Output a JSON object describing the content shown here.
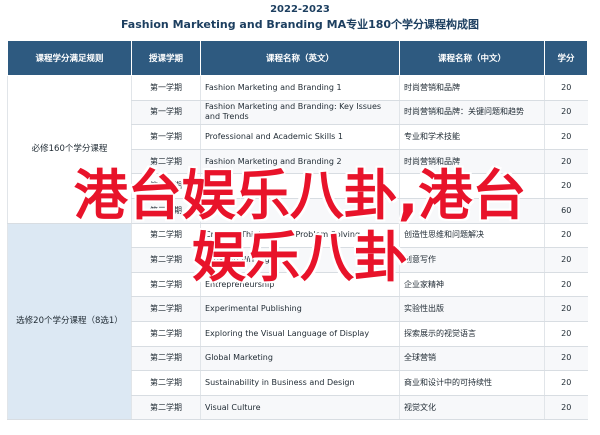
{
  "header": {
    "year": "2022-2023",
    "subtitle": "Fashion Marketing and Branding MA专业180个学分课程构成图"
  },
  "table": {
    "columns": [
      "课程学分满足规则",
      "授课学期",
      "课程名称（英文）",
      "课程名称（中文）",
      "学分"
    ],
    "groups": {
      "required": "必修160个学分课程",
      "elective": "选修20个学分课程（8选1）"
    },
    "rows": [
      {
        "term": "第一学期",
        "en": "Fashion Marketing and Branding 1",
        "zh": "时尚营销和品牌",
        "credits": "20"
      },
      {
        "term": "第一学期",
        "en": "Fashion Marketing and Branding: Key Issues and Trends",
        "zh": "时尚营销和品牌：关键问题和趋势",
        "credits": "20"
      },
      {
        "term": "第一学期",
        "en": "Professional and Academic Skills 1",
        "zh": "专业和学术技能",
        "credits": "20"
      },
      {
        "term": "第二学期",
        "en": "Fashion Marketing and Branding 2",
        "zh": "时尚营销和品牌",
        "credits": "20"
      },
      {
        "term": "第二学期",
        "en": "",
        "zh": "",
        "credits": "20"
      },
      {
        "term": "第三学期",
        "en": "",
        "zh": "",
        "credits": "60"
      },
      {
        "term": "第二学期",
        "en": "Creative Thinking and Problem Solving",
        "zh": "创造性思维和问题解决",
        "credits": "20"
      },
      {
        "term": "第二学期",
        "en": "Creative Writing",
        "zh": "创意写作",
        "credits": "20"
      },
      {
        "term": "第二学期",
        "en": "Entrepreneurship",
        "zh": "企业家精神",
        "credits": "20"
      },
      {
        "term": "第二学期",
        "en": "Experimental Publishing",
        "zh": "实验性出版",
        "credits": "20"
      },
      {
        "term": "第二学期",
        "en": "Exploring the Visual Language of Display",
        "zh": "探索展示的视觉语言",
        "credits": "20"
      },
      {
        "term": "第二学期",
        "en": "Global Marketing",
        "zh": "全球营销",
        "credits": "20"
      },
      {
        "term": "第二学期",
        "en": "Sustainability in Business and Design",
        "zh": "商业和设计中的可持续性",
        "credits": "20"
      },
      {
        "term": "第二学期",
        "en": "Visual Culture",
        "zh": "视觉文化",
        "credits": "20"
      }
    ]
  },
  "watermark": {
    "line1": "港台娱乐八卦,港台",
    "line2": "娱乐八卦"
  }
}
